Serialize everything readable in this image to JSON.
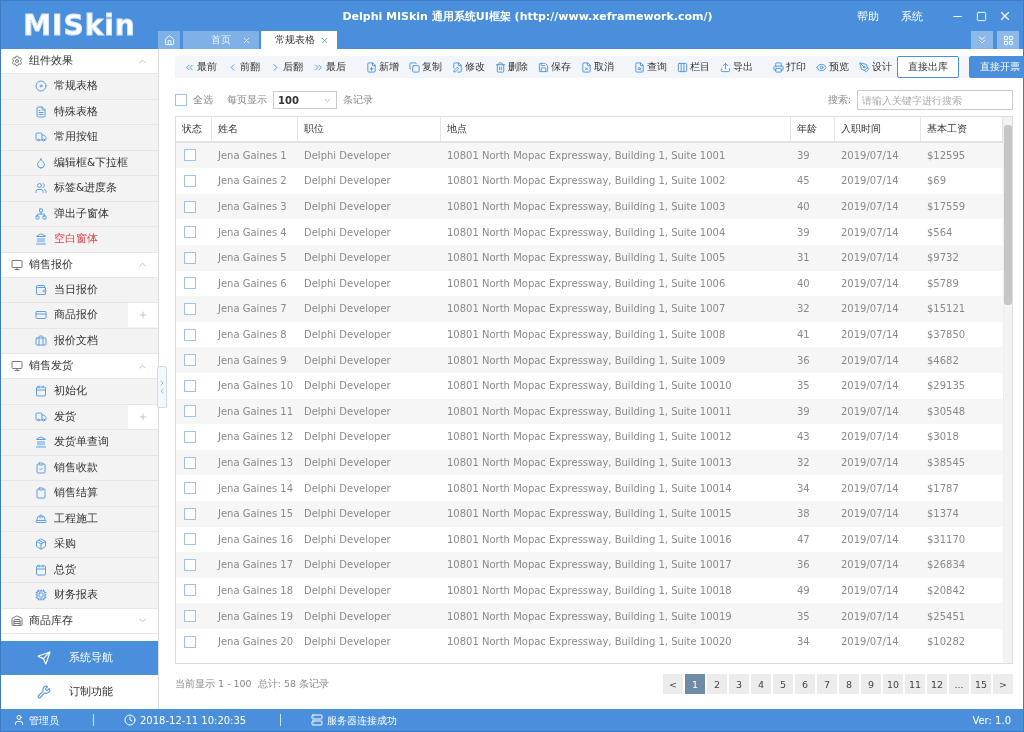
{
  "app": {
    "logo": "MISkin",
    "title": "Delphi MISkin 通用系统UI框架 (http://www.xeframework.com/)",
    "menu": [
      "帮助",
      "系统"
    ]
  },
  "tabs": [
    {
      "label": "首页",
      "selected": false
    },
    {
      "label": "常规表格",
      "selected": true
    }
  ],
  "sidebar": {
    "groups": [
      {
        "label": "组件效果",
        "expanded": true,
        "items": [
          {
            "label": "常规表格",
            "selected": false
          },
          {
            "label": "特殊表格",
            "selected": false
          },
          {
            "label": "常用按钮",
            "selected": false
          },
          {
            "label": "编辑框&下拉框",
            "selected": false
          },
          {
            "label": "标签&进度条",
            "selected": false
          },
          {
            "label": "弹出子窗体",
            "selected": false
          },
          {
            "label": "空白窗体",
            "selected": true
          }
        ]
      },
      {
        "label": "销售报价",
        "expanded": true,
        "items": [
          {
            "label": "当日报价",
            "selected": false
          },
          {
            "label": "商品报价",
            "selected": false,
            "expandable": true
          },
          {
            "label": "报价文档",
            "selected": false
          }
        ]
      },
      {
        "label": "销售发货",
        "expanded": true,
        "items": [
          {
            "label": "初始化",
            "selected": false
          },
          {
            "label": "发货",
            "selected": false,
            "expandable": true
          },
          {
            "label": "发货单查询",
            "selected": false
          },
          {
            "label": "销售收款",
            "selected": false
          },
          {
            "label": "销售结算",
            "selected": false
          },
          {
            "label": "工程施工",
            "selected": false
          },
          {
            "label": "采购",
            "selected": false
          },
          {
            "label": "总货",
            "selected": false
          },
          {
            "label": "财务报表",
            "selected": false
          }
        ]
      },
      {
        "label": "商品库存",
        "expanded": false
      }
    ],
    "bottom": [
      {
        "label": "系统导航",
        "selected": true
      },
      {
        "label": "订制功能",
        "selected": false
      }
    ]
  },
  "toolbar": {
    "groups": [
      [
        "最前",
        "前翻",
        "后翻",
        "最后"
      ],
      [
        "新增",
        "复制",
        "修改",
        "删除",
        "保存",
        "取消"
      ],
      [
        "查询",
        "栏目",
        "导出"
      ],
      [
        "打印",
        "预览",
        "设计"
      ]
    ],
    "buttons": [
      {
        "label": "直接出库",
        "primary": false
      },
      {
        "label": "直接开票",
        "primary": true
      }
    ]
  },
  "filter": {
    "select_all": {
      "label": "全选",
      "checked": false
    },
    "page_size_label": "每页显示",
    "page_size": "100",
    "records_label": "条记录",
    "search_label": "搜索:",
    "search_placeholder": "请输入关键字进行搜索"
  },
  "table": {
    "columns": [
      "状态",
      "姓名",
      "职位",
      "地点",
      "年龄",
      "入职时间",
      "基本工资"
    ],
    "rows": [
      {
        "checked": false,
        "name": "Jena Gaines 1",
        "title": "Delphi Developer",
        "address": "10801 North Mopac Expressway, Building 1, Suite 1001",
        "age": "39",
        "date": "2019/07/14",
        "salary": "$12595"
      },
      {
        "checked": false,
        "name": "Jena Gaines 2",
        "title": "Delphi Developer",
        "address": "10801 North Mopac Expressway, Building 1, Suite 1002",
        "age": "45",
        "date": "2019/07/14",
        "salary": "$69"
      },
      {
        "checked": false,
        "name": "Jena Gaines 3",
        "title": "Delphi Developer",
        "address": "10801 North Mopac Expressway, Building 1, Suite 1003",
        "age": "40",
        "date": "2019/07/14",
        "salary": "$17559"
      },
      {
        "checked": false,
        "name": "Jena Gaines 4",
        "title": "Delphi Developer",
        "address": "10801 North Mopac Expressway, Building 1, Suite 1004",
        "age": "39",
        "date": "2019/07/14",
        "salary": "$564"
      },
      {
        "checked": false,
        "name": "Jena Gaines 5",
        "title": "Delphi Developer",
        "address": "10801 North Mopac Expressway, Building 1, Suite 1005",
        "age": "31",
        "date": "2019/07/14",
        "salary": "$9732"
      },
      {
        "checked": false,
        "name": "Jena Gaines 6",
        "title": "Delphi Developer",
        "address": "10801 North Mopac Expressway, Building 1, Suite 1006",
        "age": "40",
        "date": "2019/07/14",
        "salary": "$5789"
      },
      {
        "checked": false,
        "name": "Jena Gaines 7",
        "title": "Delphi Developer",
        "address": "10801 North Mopac Expressway, Building 1, Suite 1007",
        "age": "32",
        "date": "2019/07/14",
        "salary": "$15121"
      },
      {
        "checked": false,
        "name": "Jena Gaines 8",
        "title": "Delphi Developer",
        "address": "10801 North Mopac Expressway, Building 1, Suite 1008",
        "age": "41",
        "date": "2019/07/14",
        "salary": "$37850"
      },
      {
        "checked": false,
        "name": "Jena Gaines 9",
        "title": "Delphi Developer",
        "address": "10801 North Mopac Expressway, Building 1, Suite 1009",
        "age": "36",
        "date": "2019/07/14",
        "salary": "$4682"
      },
      {
        "checked": false,
        "name": "Jena Gaines 10",
        "title": "Delphi Developer",
        "address": "10801 North Mopac Expressway, Building 1, Suite 10010",
        "age": "35",
        "date": "2019/07/14",
        "salary": "$29135"
      },
      {
        "checked": false,
        "name": "Jena Gaines 11",
        "title": "Delphi Developer",
        "address": "10801 North Mopac Expressway, Building 1, Suite 10011",
        "age": "39",
        "date": "2019/07/14",
        "salary": "$30548"
      },
      {
        "checked": false,
        "name": "Jena Gaines 12",
        "title": "Delphi Developer",
        "address": "10801 North Mopac Expressway, Building 1, Suite 10012",
        "age": "43",
        "date": "2019/07/14",
        "salary": "$3018"
      },
      {
        "checked": false,
        "name": "Jena Gaines 13",
        "title": "Delphi Developer",
        "address": "10801 North Mopac Expressway, Building 1, Suite 10013",
        "age": "32",
        "date": "2019/07/14",
        "salary": "$38545"
      },
      {
        "checked": false,
        "name": "Jena Gaines 14",
        "title": "Delphi Developer",
        "address": "10801 North Mopac Expressway, Building 1, Suite 10014",
        "age": "34",
        "date": "2019/07/14",
        "salary": "$1787"
      },
      {
        "checked": false,
        "name": "Jena Gaines 15",
        "title": "Delphi Developer",
        "address": "10801 North Mopac Expressway, Building 1, Suite 10015",
        "age": "38",
        "date": "2019/07/14",
        "salary": "$1374"
      },
      {
        "checked": false,
        "name": "Jena Gaines 16",
        "title": "Delphi Developer",
        "address": "10801 North Mopac Expressway, Building 1, Suite 10016",
        "age": "47",
        "date": "2019/07/14",
        "salary": "$31170"
      },
      {
        "checked": false,
        "name": "Jena Gaines 17",
        "title": "Delphi Developer",
        "address": "10801 North Mopac Expressway, Building 1, Suite 10017",
        "age": "36",
        "date": "2019/07/14",
        "salary": "$26834"
      },
      {
        "checked": false,
        "name": "Jena Gaines 18",
        "title": "Delphi Developer",
        "address": "10801 North Mopac Expressway, Building 1, Suite 10018",
        "age": "49",
        "date": "2019/07/14",
        "salary": "$20842"
      },
      {
        "checked": false,
        "name": "Jena Gaines 19",
        "title": "Delphi Developer",
        "address": "10801 North Mopac Expressway, Building 1, Suite 10019",
        "age": "35",
        "date": "2019/07/14",
        "salary": "$25451"
      },
      {
        "checked": false,
        "name": "Jena Gaines 20",
        "title": "Delphi Developer",
        "address": "10801 North Mopac Expressway, Building 1, Suite 10020",
        "age": "34",
        "date": "2019/07/14",
        "salary": "$10282"
      }
    ]
  },
  "footer": {
    "summary": "当前显示 1 - 100  总计: 58 条记录",
    "pages": [
      {
        "label": "<",
        "selected": false
      },
      {
        "label": "1",
        "selected": true
      },
      {
        "label": "2",
        "selected": false
      },
      {
        "label": "3",
        "selected": false
      },
      {
        "label": "4",
        "selected": false
      },
      {
        "label": "5",
        "selected": false
      },
      {
        "label": "6",
        "selected": false
      },
      {
        "label": "7",
        "selected": false
      },
      {
        "label": "8",
        "selected": false
      },
      {
        "label": "9",
        "selected": false
      },
      {
        "label": "10",
        "selected": false
      },
      {
        "label": "11",
        "selected": false
      },
      {
        "label": "12",
        "selected": false
      },
      {
        "label": "...",
        "selected": false
      },
      {
        "label": "15",
        "selected": false
      },
      {
        "label": ">",
        "selected": false
      }
    ]
  },
  "status_bar": {
    "user": "管理员",
    "time": "2018-12-11 10:20:35",
    "server": "服务器连接成功",
    "version": "Ver: 1.0"
  }
}
